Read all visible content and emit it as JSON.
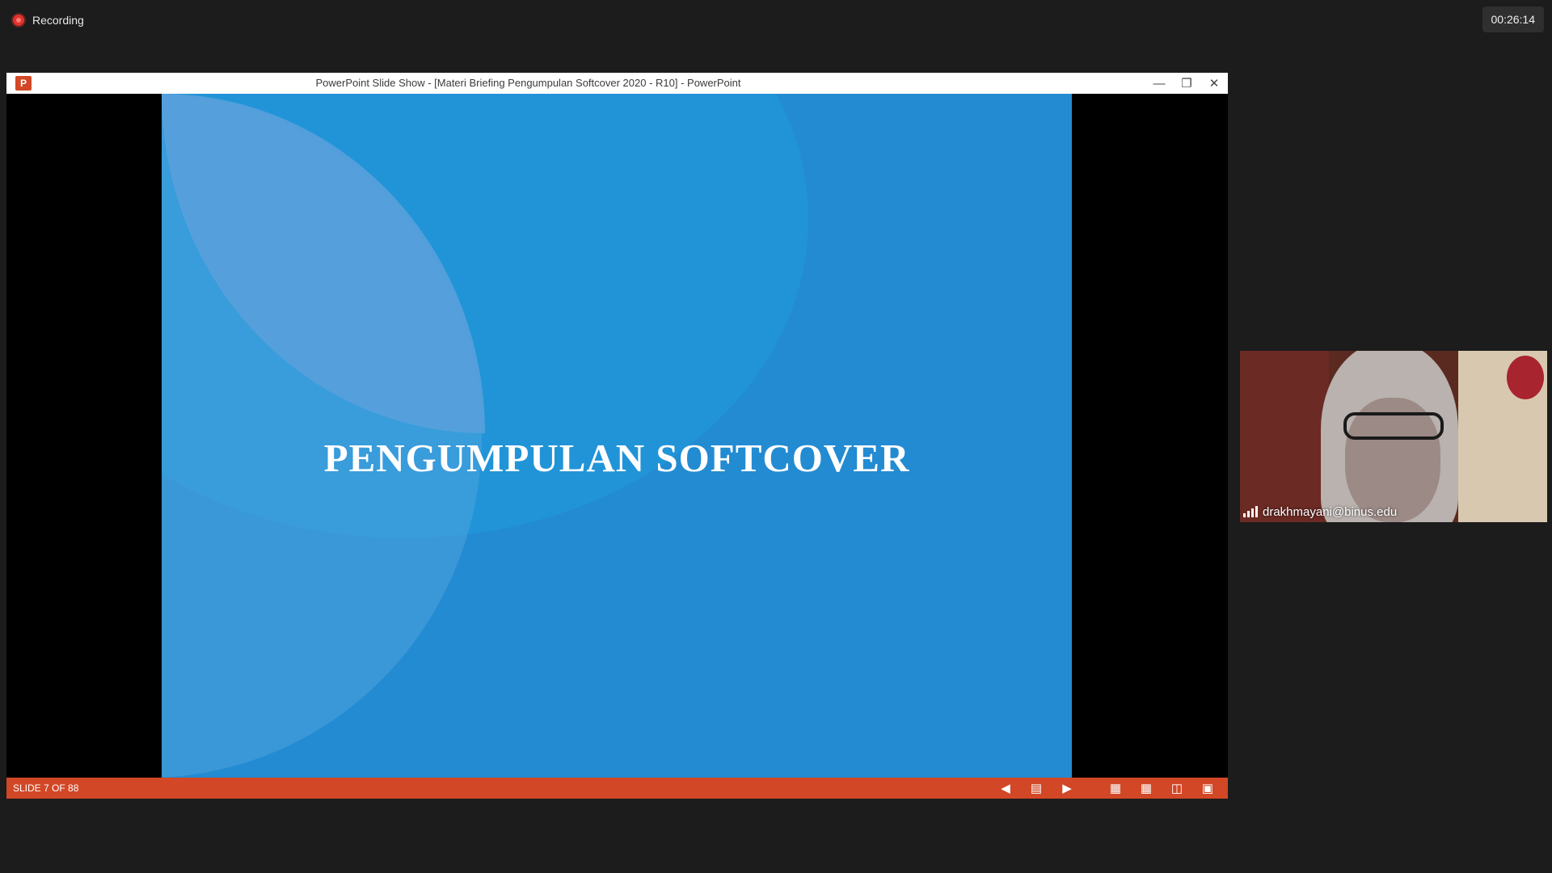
{
  "meeting": {
    "recording_label": "Recording",
    "elapsed_time": "00:26:14"
  },
  "powerpoint": {
    "app_icon_label": "P",
    "window_title": "PowerPoint Slide Show - [Materi Briefing Pengumpulan Softcover 2020 - R10] - PowerPoint",
    "slide": {
      "title": "PENGUMPULAN SOFTCOVER"
    },
    "status_bar": {
      "slide_counter": "SLIDE 7 OF 88",
      "icons": [
        "previous-slide-icon",
        "notes-icon",
        "next-slide-icon",
        "normal-view-icon",
        "slide-sorter-icon",
        "reading-view-icon",
        "slideshow-icon"
      ]
    },
    "colors": {
      "slide_background": "#238bd1",
      "status_bar": "#d24726"
    }
  },
  "participant": {
    "name": "drakhmayani@binus.edu"
  }
}
